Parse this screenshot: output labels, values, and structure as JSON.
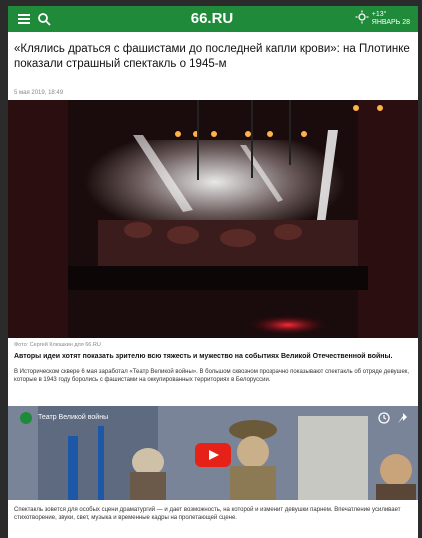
{
  "header": {
    "logo": "66.RU",
    "weather_line1": "+13°",
    "weather_line2": "ЯНВАРЬ 28"
  },
  "article": {
    "title": "«Клялись драться с фашистами до последней капли крови»: на Плотинке показали страшный спектакль о 1945-м",
    "date": "5 мая 2019, 18:49",
    "photo_credit": "Фото: Сергей Клюшкин для 66.RU",
    "lead": "Авторы идеи хотят показать зрителю всю тяжесть и мужество на событиях Великой Отечественной войны.",
    "body": "В Историческом сквере 6 мая заработал «Театр Великой войны». В большом сквозном прозрачно показывают спектакль об отряде девушек, которые в 1943 году боролись с фашистами на оккупированных территориях в Белоруссии."
  },
  "video": {
    "title": "Театр Великой войны"
  },
  "footer": {
    "text": "Спектакль зовется для особых сцени драматургий — и дает возможность, на которой и изменит девушки парнем. Впечатление усиливает стихотворение, звуки, свет, музыка и временные кадры на пролетающей сцене."
  }
}
